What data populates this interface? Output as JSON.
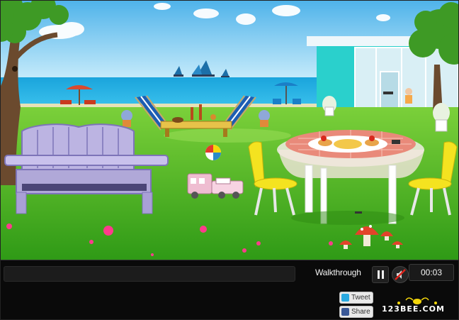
{
  "controls": {
    "walkthrough_label": "Walkthrough",
    "timer": "00:03"
  },
  "social": {
    "tweet_label": "Tweet",
    "share_label": "Share"
  },
  "branding": {
    "logo_text": "123BEE.COM"
  },
  "colors": {
    "sky": "#7cc8ee",
    "sea": "#1e9fd8",
    "grass": "#3fa81e",
    "control_bar": "#0a0a0a",
    "accent_yellow": "#f4d70b",
    "twitter_blue": "#2aa9e0",
    "facebook_blue": "#3b5998"
  },
  "icons": {
    "pause": "pause-icon",
    "mute": "speaker-muted-icon",
    "tweet": "twitter-bird-icon",
    "share": "facebook-f-icon"
  }
}
